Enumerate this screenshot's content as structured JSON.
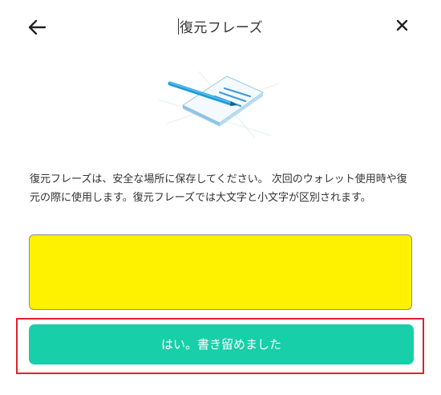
{
  "header": {
    "title": "復元フレーズ",
    "back_icon": "arrow-left-icon",
    "close_icon": "close-icon"
  },
  "illustration": {
    "icon": "notepad-with-pen-icon",
    "colors": {
      "pen": "#1e9bd6",
      "paper": "#eef6fb",
      "lines": "#4aa3dd"
    }
  },
  "description": "復元フレーズは、安全な場所に保存してください。 次回のウォレット使用時や復元の際に使用します。復元フレーズでは大文字と小文字が区別されます。",
  "phrase_box": {
    "color": "#fff200"
  },
  "confirm_button": {
    "label": "はい。書き留めました",
    "color": "#17cfa9"
  },
  "highlight": {
    "color": "#e0212e"
  }
}
